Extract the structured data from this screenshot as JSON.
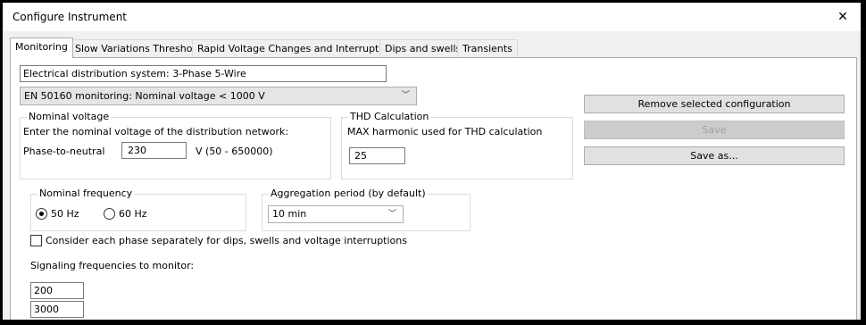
{
  "window": {
    "title": "Configure Instrument",
    "close_glyph": "✕"
  },
  "tabs": [
    {
      "label": "Monitoring",
      "active": true
    },
    {
      "label": "Slow Variations Thresholds"
    },
    {
      "label": "Rapid Voltage Changes and Interruptions"
    },
    {
      "label": "Dips and swells"
    },
    {
      "label": "Transients"
    }
  ],
  "monitoring": {
    "distribution_system": "Electrical distribution system: 3-Phase 5-Wire",
    "standard_select": {
      "selected": "EN 50160 monitoring: Nominal voltage < 1000 V",
      "icon": "chevron-down-icon"
    },
    "nominal_voltage": {
      "legend": "Nominal voltage",
      "instruction": "Enter the nominal voltage of the distribution network:",
      "label": "Phase-to-neutral",
      "value": "230",
      "unit": "V (50 - 650000)"
    },
    "thd": {
      "legend": "THD Calculation",
      "label": "MAX harmonic used for THD calculation",
      "value": "25"
    },
    "nominal_frequency": {
      "legend": "Nominal frequency",
      "options": [
        {
          "label": "50 Hz",
          "checked": true
        },
        {
          "label": "60 Hz",
          "checked": false
        }
      ]
    },
    "aggregation": {
      "legend": "Aggregation period (by default)",
      "selected": "10 min"
    },
    "consider_phases": {
      "label": "Consider each phase separately for dips, swells and voltage interruptions",
      "checked": false
    },
    "signaling": {
      "label": "Signaling frequencies to monitor:",
      "values": [
        "200",
        "3000"
      ]
    }
  },
  "actions": {
    "remove": "Remove selected configuration",
    "save": "Save",
    "save_as": "Save as..."
  }
}
